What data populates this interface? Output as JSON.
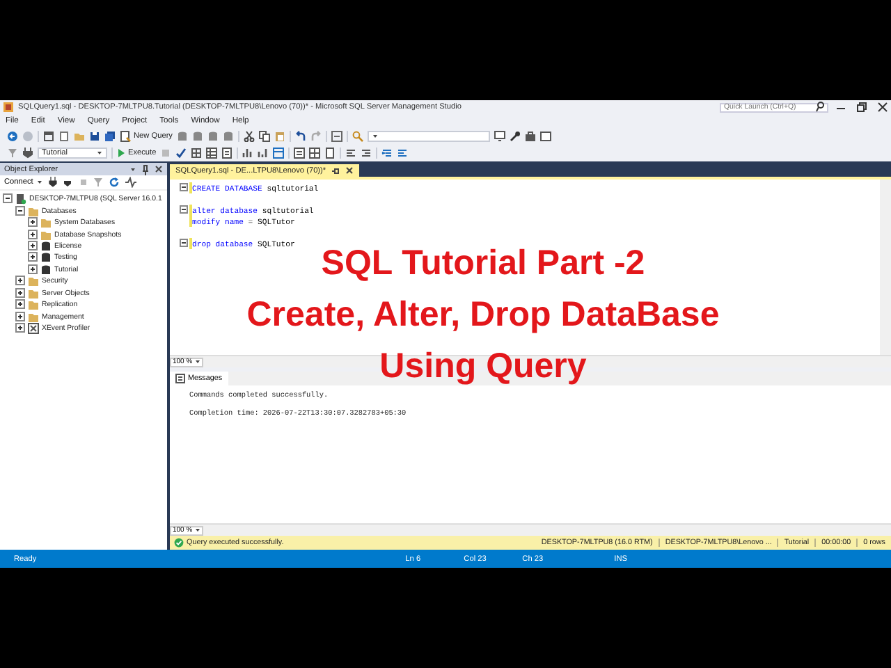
{
  "window": {
    "title": "SQLQuery1.sql - DESKTOP-7MLTPU8.Tutorial (DESKTOP-7MLTPU8\\Lenovo (70))* - Microsoft SQL Server Management Studio",
    "quick_launch": {
      "placeholder": "Quick Launch (Ctrl+Q)"
    }
  },
  "menu": [
    "File",
    "Edit",
    "View",
    "Query",
    "Project",
    "Tools",
    "Window",
    "Help"
  ],
  "toolbar": {
    "new_query": "New Query",
    "database": "Tutorial",
    "execute": "Execute"
  },
  "object_explorer": {
    "title": "Object Explorer",
    "connect": "Connect",
    "tree": [
      {
        "label": "DESKTOP-7MLTPU8 (SQL Server 16.0.1",
        "kind": "server",
        "expanded": true,
        "children": [
          {
            "label": "Databases",
            "kind": "folder",
            "expanded": true,
            "children": [
              {
                "label": "System Databases",
                "kind": "folder",
                "expanded": false
              },
              {
                "label": "Database Snapshots",
                "kind": "folder",
                "expanded": false
              },
              {
                "label": "Elicense",
                "kind": "database",
                "expanded": false
              },
              {
                "label": "Testing",
                "kind": "database",
                "expanded": false
              },
              {
                "label": "Tutorial",
                "kind": "database",
                "expanded": false
              }
            ]
          },
          {
            "label": "Security",
            "kind": "folder",
            "expanded": false
          },
          {
            "label": "Server Objects",
            "kind": "folder",
            "expanded": false
          },
          {
            "label": "Replication",
            "kind": "folder",
            "expanded": false
          },
          {
            "label": "Management",
            "kind": "folder",
            "expanded": false
          },
          {
            "label": "XEvent Profiler",
            "kind": "profiler",
            "expanded": false
          }
        ]
      }
    ]
  },
  "query_tab": {
    "title": "SQLQuery1.sql - DE...LTPU8\\Lenovo (70))*",
    "selected": true
  },
  "editor": {
    "zoom": "100 %",
    "blocks": [
      {
        "lines": [
          [
            {
              "text": "CREATE DATABASE",
              "kind": "keyword"
            },
            {
              "text": "sqltutorial",
              "kind": "name"
            }
          ]
        ]
      },
      {
        "lines": [
          [
            {
              "text": "alter database",
              "kind": "keyword"
            },
            {
              "text": "sqltutorial",
              "kind": "name"
            }
          ],
          [
            {
              "text": "modify name",
              "kind": "keyword"
            },
            {
              "text": "=",
              "kind": "operator"
            },
            {
              "text": "SQLTutor",
              "kind": "name"
            }
          ]
        ]
      },
      {
        "lines": [
          [
            {
              "text": "drop database",
              "kind": "keyword"
            },
            {
              "text": "SQLTutor",
              "kind": "name"
            }
          ]
        ]
      }
    ]
  },
  "overlay_title": [
    "SQL Tutorial Part -2",
    "Create, Alter, Drop DataBase",
    "Using Query"
  ],
  "results": {
    "zoom": "100 %",
    "tabs": [
      {
        "label": "Messages",
        "selected": true
      }
    ],
    "messages": [
      "Commands completed successfully.",
      "Completion time: 2026-07-22T13:30:07.3282783+05:30"
    ]
  },
  "query_status": {
    "message": "Query executed successfully.",
    "fields": [
      "DESKTOP-7MLTPU8 (16.0 RTM)",
      "DESKTOP-7MLTPU8\\Lenovo ...",
      "Tutorial",
      "00:00:00",
      "0 rows"
    ]
  },
  "status_bar": {
    "state": "Ready",
    "fields": [
      "Ln 6",
      "Col 23",
      "Ch 23",
      "INS"
    ]
  }
}
